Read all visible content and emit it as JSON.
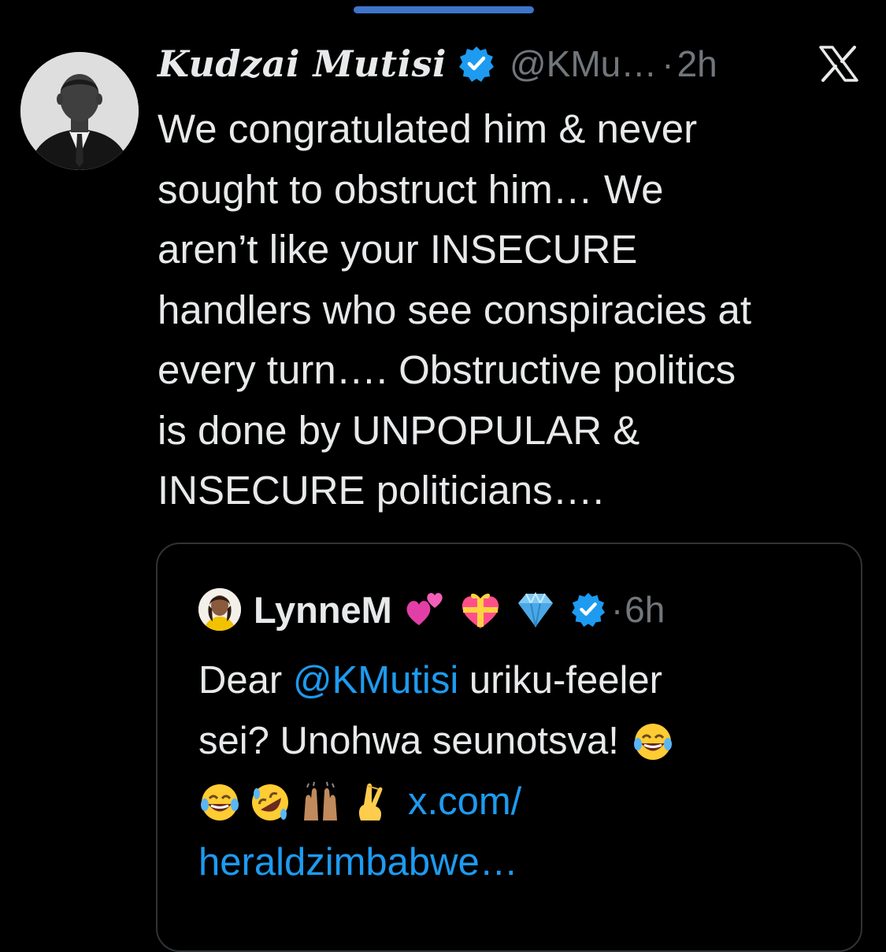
{
  "tweet": {
    "author": {
      "display_name": "Kudzai Mutisi",
      "handle": "@KMu…",
      "verified": true,
      "avatar_icon": "profile-photo"
    },
    "separator": "·",
    "time": "2h",
    "platform_icon": "x-logo",
    "text": "We congratulated him & never\nsought to obstruct him… We\naren’t like your INSECURE\nhandlers who see conspiracies at\nevery turn…. Obstructive politics\nis done by UNPOPULAR &\nINSECURE politicians…."
  },
  "quoted_tweet": {
    "author": {
      "display_name": "LynneM",
      "verified": true,
      "avatar_icon": "profile-photo",
      "name_emojis": [
        "two-hearts-emoji",
        "heart-with-ribbon-emoji",
        "gem-stone-emoji"
      ]
    },
    "separator": "·",
    "time": "6h",
    "text": {
      "line1_prefix": "Dear ",
      "mention": "@KMutisi",
      "line1_suffix": " uriku-feeler",
      "line2": "sei? Unohwa seunotsva!",
      "line2_emoji": "face-with-tears-of-joy-emoji",
      "line3_emojis": [
        "face-with-tears-of-joy-emoji",
        "rolling-on-floor-laughing-emoji",
        "raising-hands-emoji",
        "crossed-fingers-emoji"
      ],
      "link_line1": "x.com/",
      "link_line2": "heraldzimbabwe…"
    }
  },
  "colors": {
    "background": "#000000",
    "primary_text": "#e7e9ea",
    "secondary_text": "#71767b",
    "link": "#1d9bf0",
    "verified_badge": "#1d9bf0",
    "card_border": "#2f3336",
    "drag_handle": "#3e74c9"
  }
}
